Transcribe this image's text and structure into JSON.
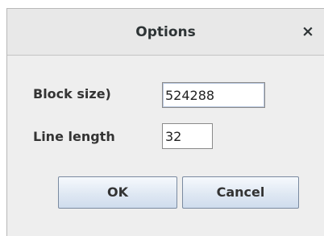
{
  "dialog": {
    "title": "Options",
    "close_glyph": "×"
  },
  "form": {
    "block_size": {
      "label": "Block size)",
      "value": "524288"
    },
    "line_length": {
      "label": "Line length",
      "value": "32"
    }
  },
  "buttons": {
    "ok_label": "OK",
    "cancel_label": "Cancel"
  },
  "icons": {
    "close": "close-icon"
  }
}
